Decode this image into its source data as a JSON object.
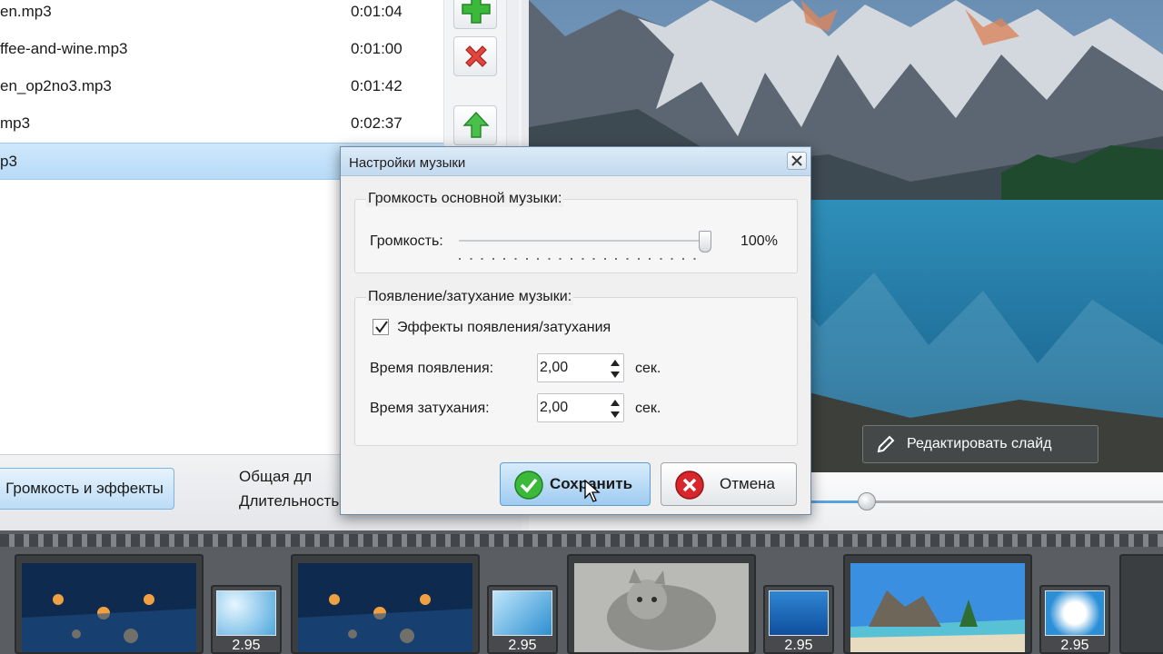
{
  "playlist": {
    "tracks": [
      {
        "name": "en.mp3",
        "duration": "0:01:04"
      },
      {
        "name": "ffee-and-wine.mp3",
        "duration": "0:01:00"
      },
      {
        "name": "en_op2no3.mp3",
        "duration": "0:01:42"
      },
      {
        "name": "mp3",
        "duration": "0:02:37"
      },
      {
        "name": "p3",
        "duration": ""
      }
    ],
    "selected_index": 4,
    "volume_effects_label": "Громкость и эффекты",
    "info_line1": "Общая дл",
    "info_line2": "Длительность"
  },
  "preview": {
    "edit_slide_label": "Редактировать слайд"
  },
  "dialog": {
    "title": "Настройки музыки",
    "volume_group_title": "Громкость основной музыки:",
    "volume_label": "Громкость:",
    "volume_value": "100%",
    "volume_level": 1.0,
    "fade_group_title": "Появление/затухание музыки:",
    "fade_checkbox_label": "Эффекты появления/затухания",
    "fade_checked": true,
    "fade_in_label": "Время появления:",
    "fade_in_value": "2,00",
    "fade_out_label": "Время затухания:",
    "fade_out_value": "2,00",
    "unit": "сек.",
    "save_label": "Сохранить",
    "cancel_label": "Отмена"
  },
  "filmstrip": {
    "transition_duration": "2.95"
  },
  "colors": {
    "selection": "#b7dbf7",
    "accent": "#5aa3df",
    "ok_green": "#3cb83a",
    "cancel_red": "#d9262c"
  }
}
